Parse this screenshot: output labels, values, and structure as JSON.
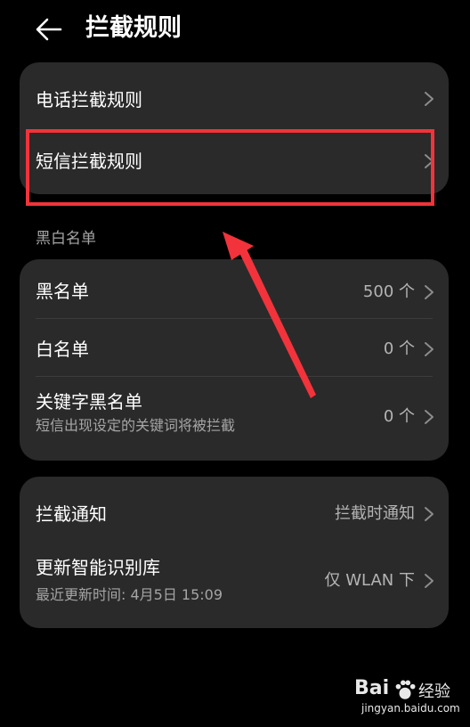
{
  "header": {
    "title": "拦截规则"
  },
  "rules": [
    {
      "label": "电话拦截规则"
    },
    {
      "label": "短信拦截规则"
    }
  ],
  "lists_section": {
    "label": "黑白名单",
    "items": [
      {
        "label": "黑名单",
        "value": "500 个"
      },
      {
        "label": "白名单",
        "value": "0 个"
      },
      {
        "label": "关键字黑名单",
        "sub": "短信出现设定的关键词将被拦截",
        "value": "0 个"
      }
    ]
  },
  "settings": [
    {
      "label": "拦截通知",
      "value": "拦截时通知"
    },
    {
      "label": "更新智能识别库",
      "sub": "最近更新时间: 4月5日 15:09",
      "value": "仅 WLAN 下"
    }
  ],
  "watermark": {
    "brand": "Bai",
    "brand_suffix": "经验",
    "url": "jingyan.baidu.com"
  },
  "colors": {
    "background": "#000000",
    "card": "#2a2a2a",
    "highlight": "#f2333b",
    "secondary_text": "#a5a5a5"
  }
}
